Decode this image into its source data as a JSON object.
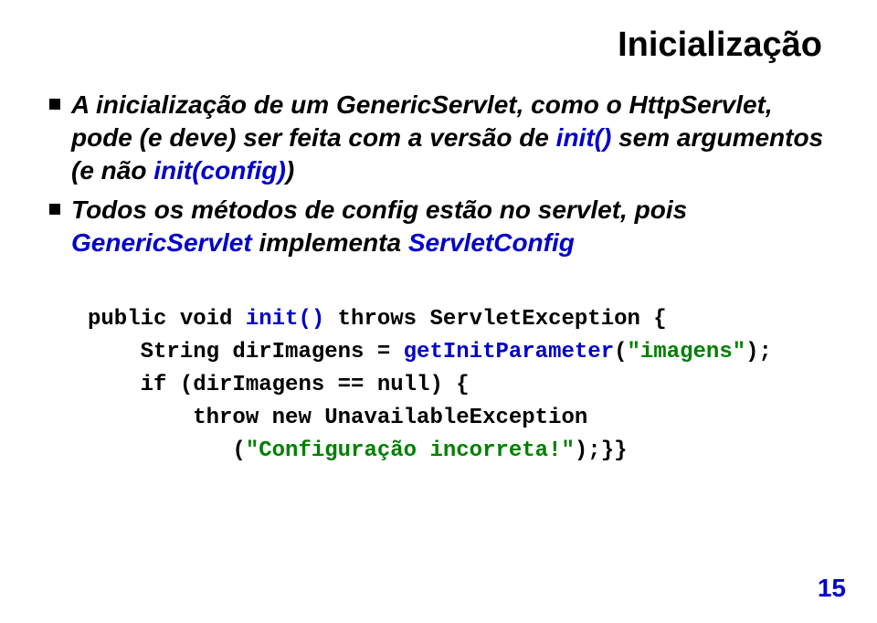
{
  "title": "Inicialização",
  "bullets": [
    {
      "prefix": "A inicialização de um GenericServlet, como o HttpServlet, pode (e deve) ser feita com a versão de ",
      "blue1": "init()",
      "mid1": " sem argumentos (e não ",
      "blue2": "init(config)",
      "suffix": ")"
    },
    {
      "prefix": "Todos os métodos de config estão no servlet, pois ",
      "blue1": "GenericServlet",
      "mid1": " implementa ",
      "blue2": "ServletConfig",
      "suffix": ""
    }
  ],
  "code": {
    "l1a": "public void ",
    "l1b": "init()",
    "l1c": " throws ServletException {",
    "l2a": "    String dirImagens = ",
    "l2b": "getInitParameter",
    "l2c": "(",
    "l2d": "\"imagens\"",
    "l2e": ");",
    "l3": "    if (dirImagens == null) {",
    "l4": "        throw new UnavailableException",
    "l5a": "           (",
    "l5b": "\"Configuração incorreta!\"",
    "l5c": ");}}"
  },
  "pageNumber": "15"
}
